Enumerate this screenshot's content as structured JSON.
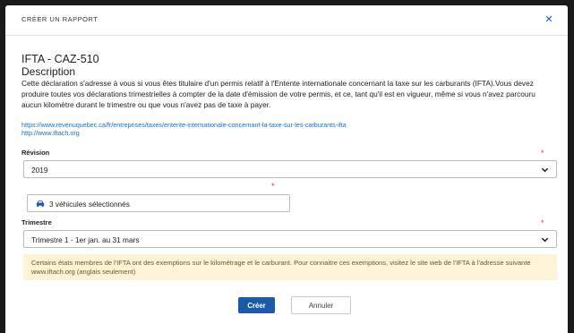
{
  "header": {
    "title": "CRÉER UN RAPPORT",
    "close_icon": "close-icon"
  },
  "report": {
    "title": "IFTA - CAZ-510",
    "subtitle": "Description",
    "description": "Cette déclaration s'adresse à vous si vous êtes titulaire d'un permis relatif à l'Entente internationale concernant la taxe sur les carburants (IFTA).Vous devez produire toutes vos déclarations trimestrielles à compter de la date d'émission de votre permis, et ce, tant qu'il est en vigueur, même si vous n'avez parcouru aucun kilomètre durant le trimestre ou que vous n'avez pas de taxe à payer.",
    "link1": "https://www.revenuquebec.ca/fr/entreprises/taxes/entente-internationale-concernant-la-taxe-sur-les-carburants-ifta",
    "link2": "http://www.iftach.org"
  },
  "form": {
    "revision_label": "Révision",
    "revision_value": "2019",
    "vehicles_value": "3 véhicules sélectionnés",
    "vehicles_icon": "car-icon",
    "quarter_label": "Trimestre",
    "quarter_value": "Trimestre 1 - 1er jan. au 31 mars",
    "required_mark": "*"
  },
  "note": "Certains états membres de l'IFTA ont des exemptions sur le kilométrage et le carburant. Pour connaitre ces exemptions, visitez le site web de l'IFTA à l'adresse suivante www.iftach.org (anglais seulement)",
  "buttons": {
    "create": "Créer",
    "cancel": "Annuler"
  },
  "colors": {
    "primary": "#1a5aa8",
    "required": "#d9363e",
    "link": "#1a6fbd",
    "note_bg": "#fdf3d6"
  }
}
